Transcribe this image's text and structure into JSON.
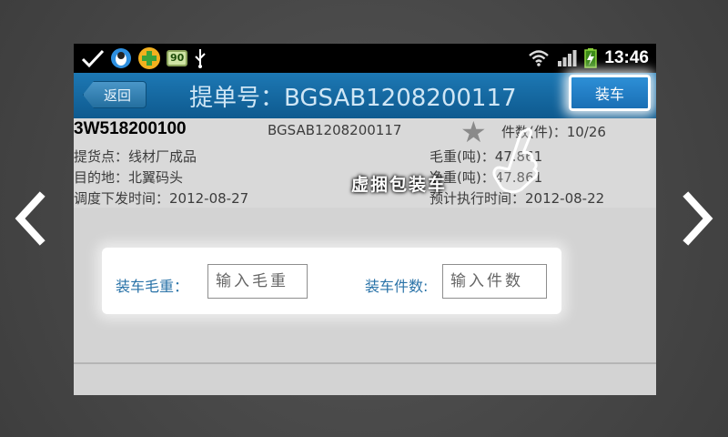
{
  "statusbar": {
    "battery_level": "90",
    "time": "13:46"
  },
  "titlebar": {
    "back_label": "返回",
    "title": "提单号：BGSAB1208200117",
    "load_label": "装车"
  },
  "order": {
    "code_primary": "3W518200100",
    "code_secondary": "BGSAB1208200117",
    "pieces": "件数(件)：10/26",
    "pickup": "提货点：线材厂成品",
    "destination": "目的地：北翼码头",
    "dispatch_time": "调度下发时间：2012-08-27",
    "gross_weight": "毛重(吨)：47.861",
    "net_weight": "净重(吨)：47.861",
    "planned_time": "预计执行时间：2012-08-22"
  },
  "form": {
    "weight_label": "装车毛重：",
    "weight_placeholder": "输入毛重",
    "count_label": "装车件数:",
    "count_placeholder": "输入件数"
  },
  "tutorial": {
    "tip": "虚捆包装车"
  },
  "colors": {
    "titlebar": "#1267a3",
    "accent_button": "#2a8ad2",
    "label_blue": "#2a73a8"
  }
}
